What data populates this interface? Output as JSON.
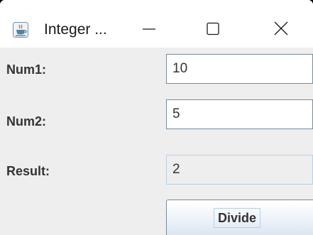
{
  "window": {
    "title": "Integer ...",
    "icon": "java-icon",
    "controls": [
      "minimize-icon",
      "maximize-icon",
      "close-icon"
    ]
  },
  "form": {
    "num1_label": "Num1:",
    "num1_value": "10",
    "num2_label": "Num2:",
    "num2_value": "5",
    "result_label": "Result:",
    "result_value": "2",
    "divide_label": "Divide"
  },
  "colors": {
    "background": "#eeeeee",
    "field_border": "#7a8a99",
    "disabled_field_border": "#b8cfe5",
    "text": "#333333"
  }
}
